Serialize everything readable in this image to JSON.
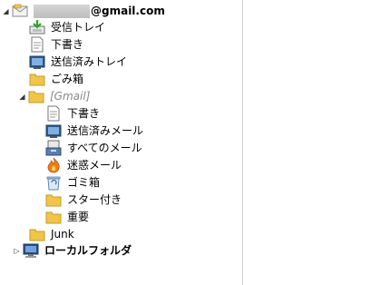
{
  "account": {
    "email_suffix": "@gmail.com"
  },
  "folders": {
    "inbox": "受信トレイ",
    "drafts": "下書き",
    "sent": "送信済みトレイ",
    "trash": "ごみ箱",
    "gmail_group": "[Gmail]",
    "gmail_drafts": "下書き",
    "gmail_sent": "送信済みメール",
    "gmail_all": "すべてのメール",
    "gmail_spam": "迷惑メール",
    "gmail_trash": "ゴミ箱",
    "gmail_starred": "スター付き",
    "gmail_important": "重要",
    "junk": "Junk",
    "local": "ローカルフォルダ"
  },
  "colors": {
    "folder_yellow": "#f0c64a",
    "border_gray": "#cfcfcf",
    "gmail_label_gray": "#888888"
  }
}
